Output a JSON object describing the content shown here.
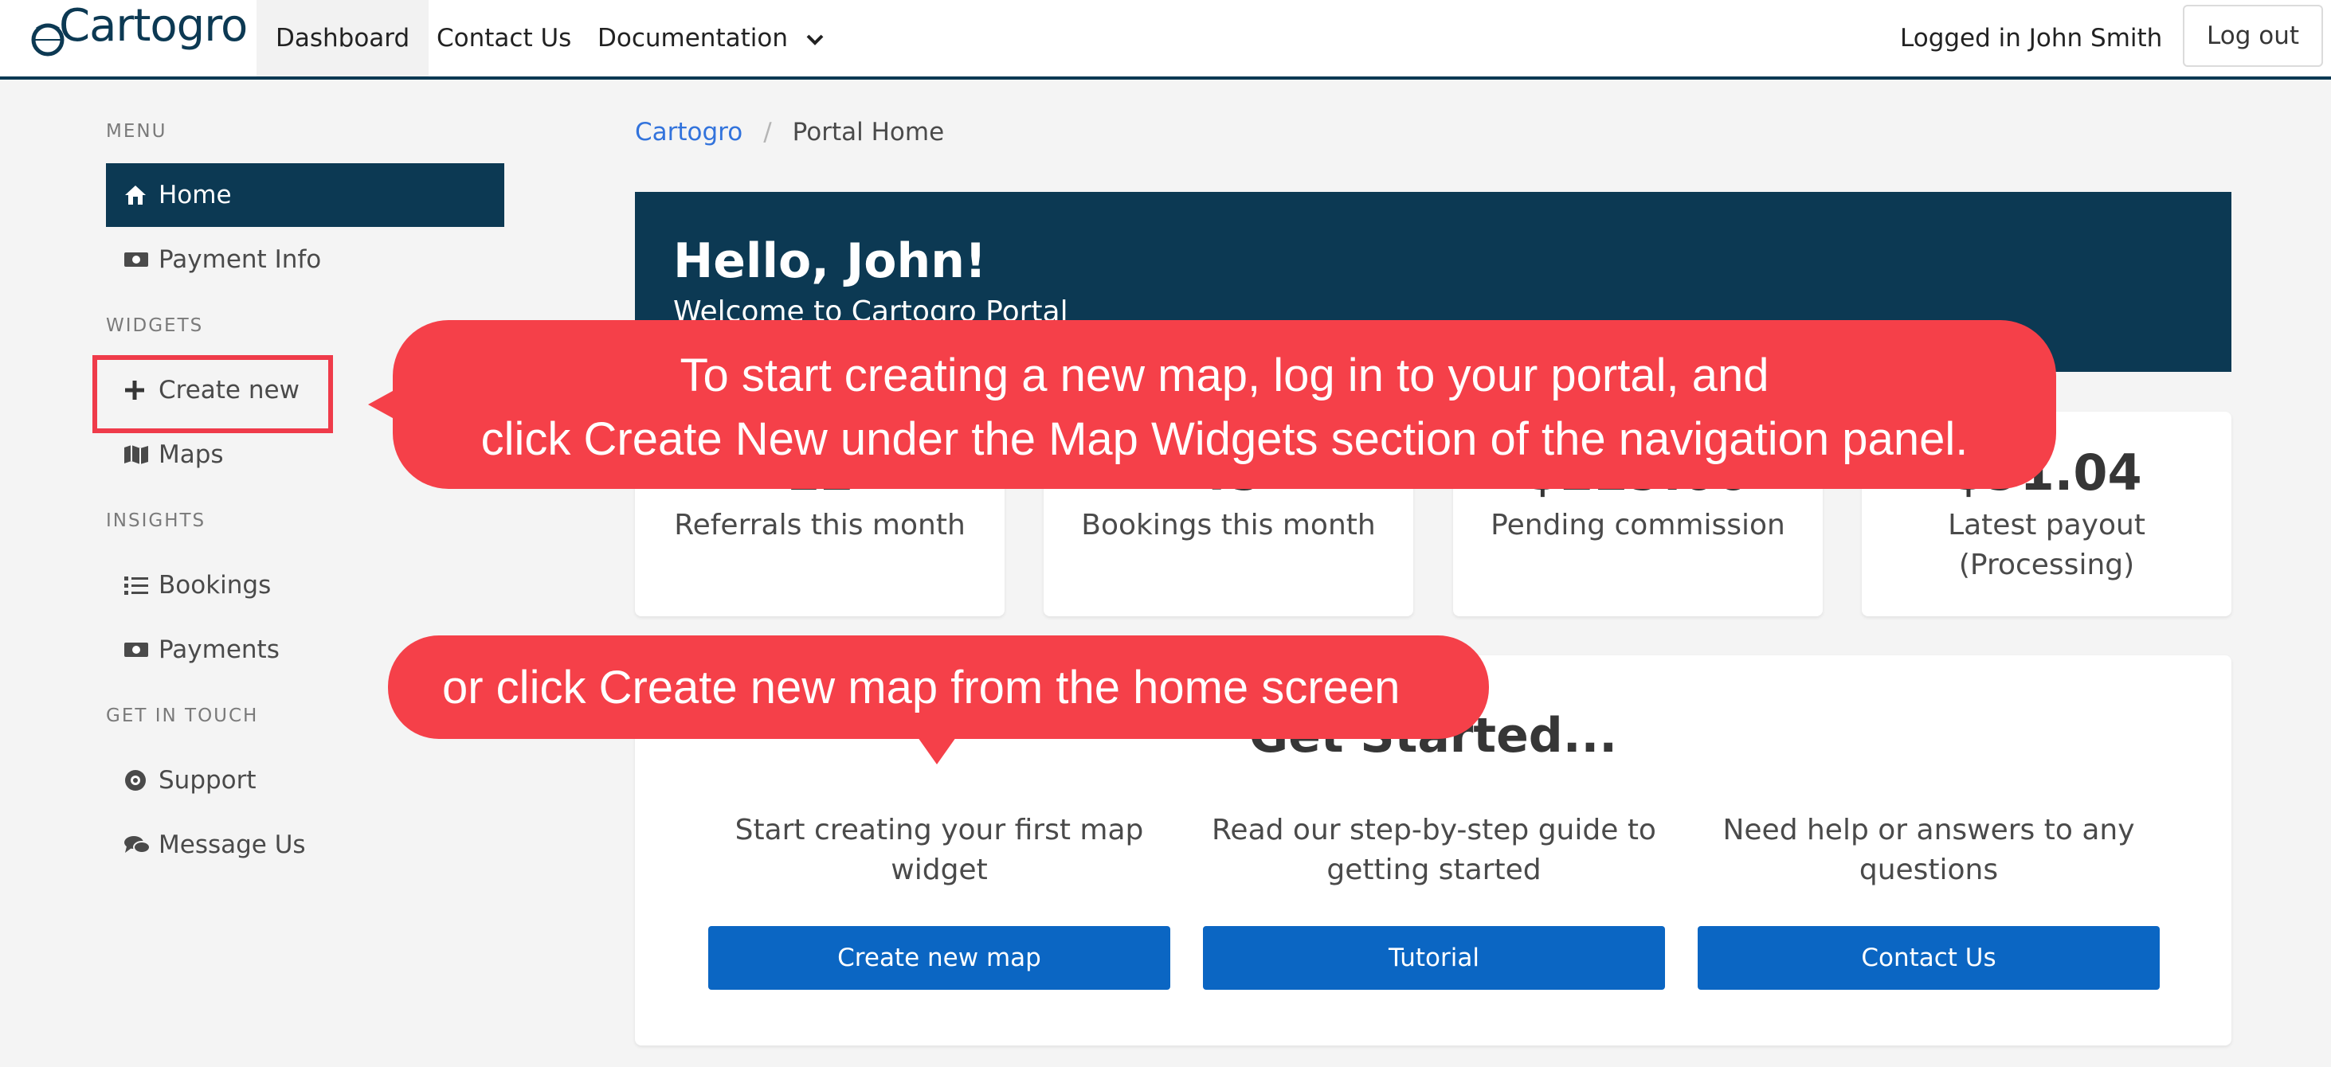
{
  "navbar": {
    "logo": "Cartogro",
    "items": [
      {
        "label": "Dashboard"
      },
      {
        "label": "Contact Us"
      },
      {
        "label": "Documentation"
      }
    ],
    "user_status": "Logged in John Smith",
    "logout_label": "Log out"
  },
  "sidebar": {
    "sections": [
      {
        "label": "MENU"
      },
      {
        "label": "WIDGETS"
      },
      {
        "label": "INSIGHTS"
      },
      {
        "label": "GET IN TOUCH"
      }
    ],
    "items": [
      {
        "label": "Home",
        "icon": "home-icon"
      },
      {
        "label": "Payment Info",
        "icon": "money-icon"
      },
      {
        "label": "Create new",
        "icon": "plus-icon"
      },
      {
        "label": "Maps",
        "icon": "map-icon"
      },
      {
        "label": "Bookings",
        "icon": "list-icon"
      },
      {
        "label": "Payments",
        "icon": "money-icon"
      },
      {
        "label": "Support",
        "icon": "life-ring-icon"
      },
      {
        "label": "Message Us",
        "icon": "comments-icon"
      }
    ]
  },
  "breadcrumb": {
    "root": "Cartogro",
    "separator": "/",
    "current": "Portal Home"
  },
  "hero": {
    "title": "Hello, John!",
    "subtitle": "Welcome to Cartogro Portal"
  },
  "stats": [
    {
      "value": "12",
      "label": "Referrals this month"
    },
    {
      "value": "45",
      "label": "Bookings this month"
    },
    {
      "value": "$229.00",
      "label": "Pending commission"
    },
    {
      "value": "$91.04",
      "label": "Latest payout (Processing)"
    }
  ],
  "get_started": {
    "title": "Get Started...",
    "columns": [
      {
        "text": "Start creating your first map widget",
        "button": "Create new map"
      },
      {
        "text": "Read our step-by-step guide to getting started",
        "button": "Tutorial"
      },
      {
        "text": "Need help or answers to any questions",
        "button": "Contact Us"
      }
    ]
  },
  "callouts": {
    "first_line1": "To start creating a new map, log in to your portal, and",
    "first_line2": "click Create New under the Map Widgets section of the navigation panel.",
    "second": "or click Create new map from the home screen"
  },
  "colors": {
    "brand_navy": "#0c3953",
    "button_blue": "#0b66c3",
    "callout_red": "#f54049",
    "link_blue": "#3273dc"
  }
}
